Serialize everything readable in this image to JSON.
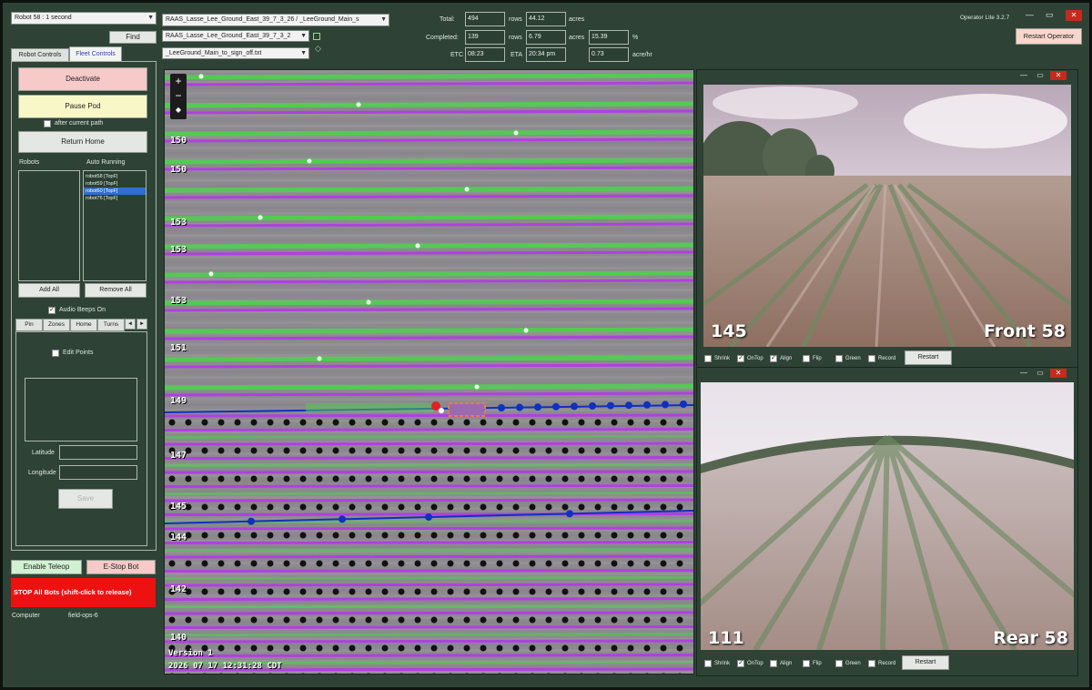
{
  "window": {
    "title": "Operator Lite 3.2.7",
    "restart_operator": "Restart Operator",
    "min": "—",
    "max": "▭",
    "close": "✕"
  },
  "robot_select": "Robot 58 : 1 second",
  "find_button": "Find",
  "tabs": [
    "Robot Controls",
    "Fleet Controls"
  ],
  "fleet": {
    "deactivate": "Deactivate",
    "pause_pod": "Pause Pod",
    "after_current_path": "after current path",
    "return_home": "Return Home",
    "robots_label": "Robots",
    "auto_running_label": "Auto Running",
    "auto_running_items": [
      "robot58 [TopF]",
      "robot59 [TopF]",
      "robot60 [TopF]",
      "robot76 [TopF]"
    ],
    "add_all": "Add All",
    "remove_all": "Remove All",
    "audio_beeps": "Audio Beeps On"
  },
  "subtabs": [
    "Pin",
    "Zones",
    "Home",
    "Turns"
  ],
  "subtab_scroll": [
    "◄",
    "►"
  ],
  "pin": {
    "edit_points": "Edit Points",
    "latitude": "Latitude",
    "longitude": "Longitude",
    "save": "Save"
  },
  "bottom": {
    "enable_teleop": "Enable Teleop",
    "estop_bot": "E-Stop Bot",
    "stop_all": "STOP All Bots   (shift-click to release)",
    "computer_label": "Computer",
    "computer_value": "field-ops-6"
  },
  "files": {
    "file1": "RAAS_Lasse_Lee_Ground_East_39_7_3_26 / _LeeGround_Main_s",
    "file2": "RAAS_Lasse_Lee_Ground_East_39_7_3_2",
    "file3": "_LeeGround_Main_to_sign_off.txt"
  },
  "stats": {
    "total_label": "Total:",
    "total_value": "494",
    "rows_label": "rows",
    "rows_value": "44.12",
    "acres_label": "acres",
    "completed_label": "Completed:",
    "completed_value": "139",
    "rows2_value": "6.79",
    "acres2_value": "15.39",
    "percent_label": "%",
    "etc_label": "ETC",
    "etc_value": "08:23",
    "eta_label": "ETA",
    "eta_value": "20:34 pm",
    "rate_value": "0.73",
    "rate_label": "acre/hr"
  },
  "map": {
    "zoom_in": "+",
    "zoom_out": "−",
    "reset": "◆",
    "row_labels": [
      "150",
      "150",
      "153",
      "153",
      "153",
      "151",
      "149",
      "147",
      "145",
      "144",
      "142",
      "140"
    ],
    "version": "Version 1",
    "timestamp": "2026 07 17 12:31:28 CDT",
    "colors": {
      "planned": "#50d050",
      "done": "#b040e0",
      "path": "#1030c0",
      "dots": "#111111",
      "robot": "#e08040"
    }
  },
  "front_cam": {
    "count": "145",
    "name": "Front 58",
    "toggles": [
      "Shrink",
      "OnTop",
      "Align",
      "Flip",
      "Green",
      "Record"
    ],
    "checked": [
      false,
      true,
      true,
      false,
      false,
      false
    ],
    "restart": "Restart"
  },
  "rear_cam": {
    "count": "111",
    "name": "Rear 58",
    "toggles": [
      "Shrink",
      "OnTop",
      "Align",
      "Flip",
      "Green",
      "Record"
    ],
    "checked": [
      false,
      true,
      false,
      false,
      false,
      false
    ],
    "restart": "Restart"
  }
}
